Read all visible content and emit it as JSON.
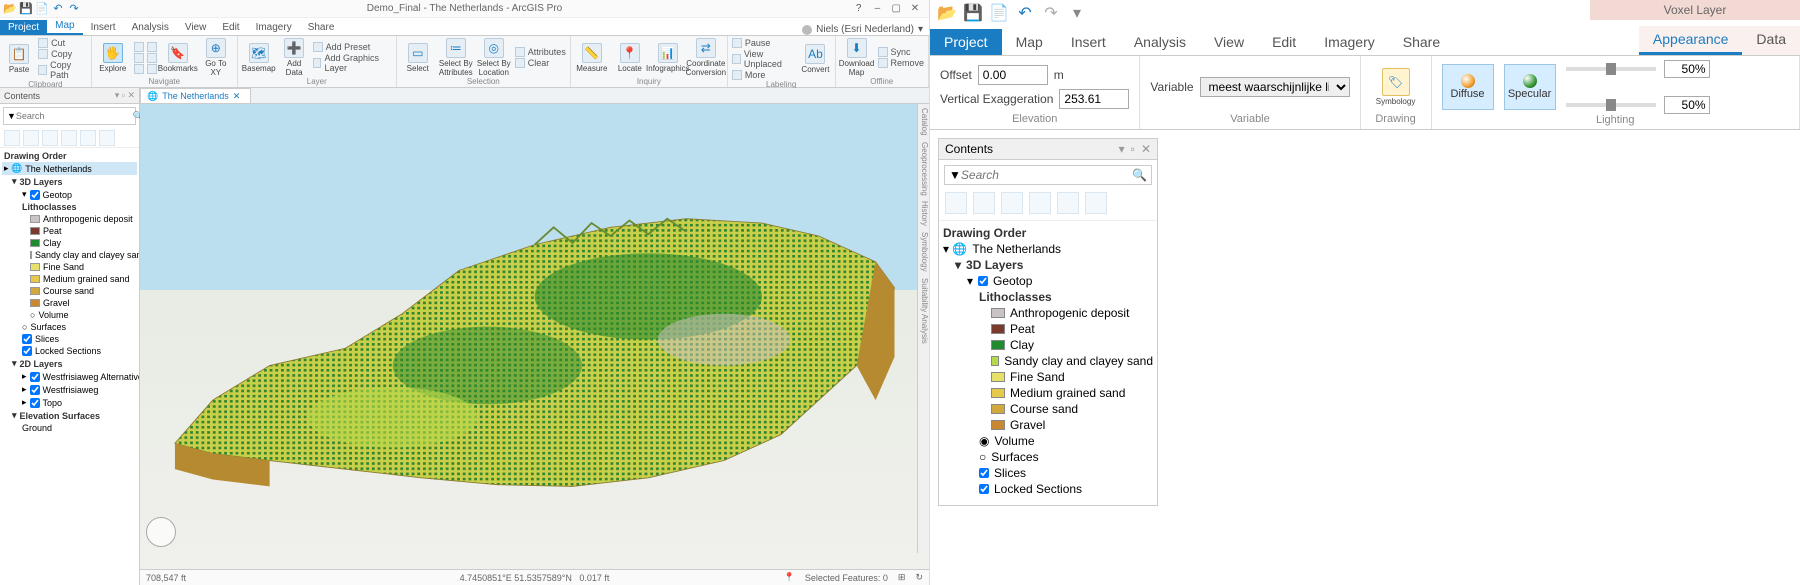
{
  "app": {
    "title": "Demo_Final - The Netherlands - ArcGIS Pro",
    "signin": "Niels (Esri Nederland)",
    "help_icon": "?",
    "win_min": "–",
    "win_max": "▢",
    "win_close": "✕"
  },
  "qat_icons": [
    "folder",
    "save",
    "new",
    "undo",
    "redo"
  ],
  "ribbon_tabs": {
    "file": "Project",
    "items": [
      "Map",
      "Insert",
      "Analysis",
      "View",
      "Edit",
      "Imagery",
      "Share"
    ],
    "active": "Map"
  },
  "ribbon": {
    "clipboard": {
      "label": "Clipboard",
      "paste": "Paste",
      "cut": "Cut",
      "copy": "Copy",
      "copypath": "Copy Path"
    },
    "navigate": {
      "label": "Navigate",
      "explore": "Explore",
      "bookmarks": "Bookmarks",
      "goxy": "Go\nTo XY"
    },
    "layer": {
      "label": "Layer",
      "basemap": "Basemap",
      "adddata": "Add\nData",
      "addpreset": "Add Preset",
      "addgraphics": "Add Graphics Layer"
    },
    "selection": {
      "label": "Selection",
      "select": "Select",
      "byattr": "Select By\nAttributes",
      "byloc": "Select By\nLocation",
      "attributes": "Attributes",
      "clear": "Clear"
    },
    "inquiry": {
      "label": "Inquiry",
      "measure": "Measure",
      "locate": "Locate",
      "infog": "Infographics",
      "coord": "Coordinate\nConversion"
    },
    "labeling": {
      "label": "Labeling",
      "pause": "Pause",
      "viewunp": "View Unplaced",
      "more": "More",
      "convert": "Convert"
    },
    "offline": {
      "label": "Offline",
      "download": "Download\nMap",
      "sync": "Sync",
      "remove": "Remove"
    }
  },
  "contents": {
    "title": "Contents",
    "search_placeholder": "Search",
    "drawing_order": "Drawing Order",
    "map_name": "The Netherlands",
    "group_3d": "3D Layers",
    "layer_geotop": "Geotop",
    "litho_header": "Lithoclasses",
    "litho": [
      {
        "name": "Anthropogenic deposit",
        "color": "#c9c2c6"
      },
      {
        "name": "Peat",
        "color": "#7a3b2e"
      },
      {
        "name": "Clay",
        "color": "#1f8a2f"
      },
      {
        "name": "Sandy clay and clayey sand",
        "color": "#b8d84a"
      },
      {
        "name": "Fine Sand",
        "color": "#e7e16a"
      },
      {
        "name": "Medium grained sand",
        "color": "#e6c84a"
      },
      {
        "name": "Course sand",
        "color": "#d1a83c"
      },
      {
        "name": "Gravel",
        "color": "#c9872f"
      }
    ],
    "volume": "Volume",
    "surfaces": "Surfaces",
    "slices": "Slices",
    "locked": "Locked Sections",
    "group_2d": "2D Layers",
    "layers2d": [
      "Westfrisiaweg Alternative",
      "Westfrisiaweg",
      "Topo"
    ],
    "elev": "Elevation Surfaces",
    "ground": "Ground"
  },
  "map": {
    "tab": "The Netherlands",
    "status_left": "708,547 ft",
    "status_center": "4.7450851°E 51.5357589°N",
    "status_elev": "0.017 ft",
    "status_sel": "Selected Features: 0",
    "side_tabs": [
      "Catalog",
      "Geoprocessing",
      "History",
      "Symbology",
      "Suitability Analysis"
    ]
  },
  "right": {
    "context_title": "Voxel Layer",
    "tabs": {
      "file": "Project",
      "items": [
        "Map",
        "Insert",
        "Analysis",
        "View",
        "Edit",
        "Imagery",
        "Share"
      ],
      "ctx": [
        "Appearance",
        "Data"
      ],
      "active": "Appearance"
    },
    "elevation": {
      "label": "Elevation",
      "offset_lbl": "Offset",
      "offset": "0.00",
      "unit": "m",
      "vexag_lbl": "Vertical Exaggeration",
      "vexag": "253.61"
    },
    "variable": {
      "label": "Variable",
      "lbl": "Variable",
      "value": "meest waarschijnlijke litl"
    },
    "drawing": {
      "label": "Drawing",
      "btn": "Symbology"
    },
    "lighting": {
      "label": "Lighting",
      "diffuse": "Diffuse",
      "specular": "Specular",
      "pct": "50%"
    },
    "contents": {
      "title": "Contents",
      "search": "Search",
      "drawing_order": "Drawing Order",
      "map": "The Netherlands",
      "group_3d": "3D Layers",
      "geotop": "Geotop",
      "litho_header": "Lithoclasses",
      "volume": "Volume",
      "surfaces": "Surfaces",
      "slices": "Slices",
      "locked": "Locked Sections"
    }
  }
}
